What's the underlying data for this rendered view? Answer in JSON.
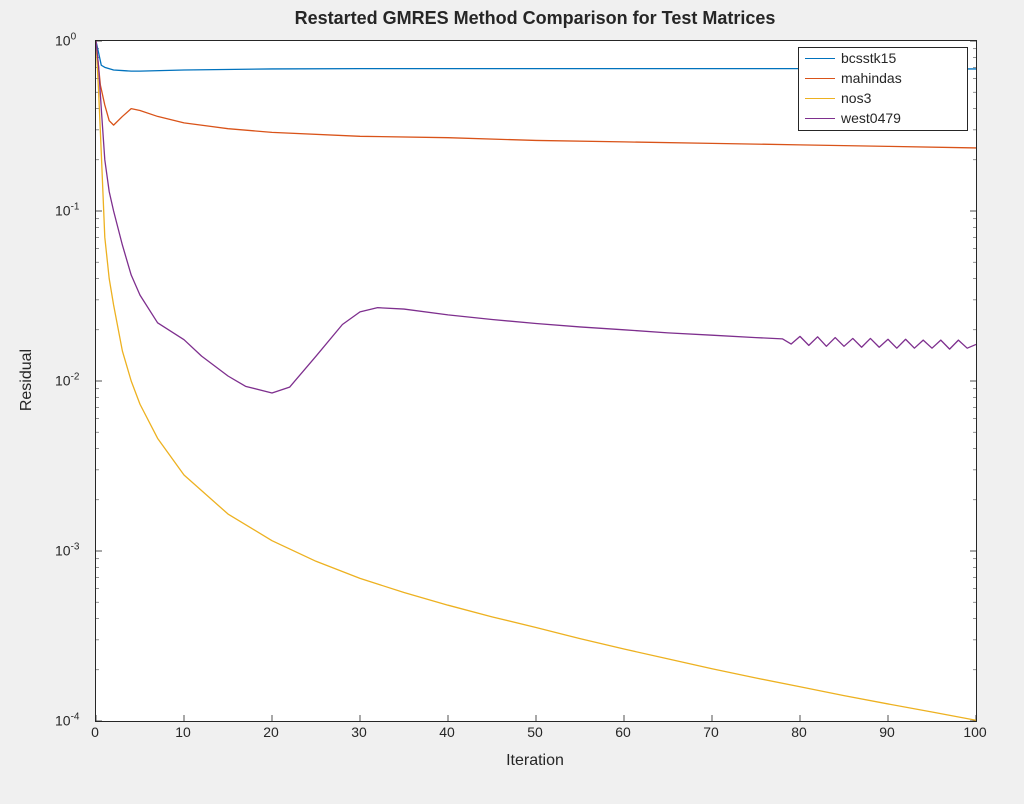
{
  "title": "Restarted GMRES Method Comparison for Test Matrices",
  "xlabel": "Iteration",
  "ylabel": "Residual",
  "xticks": [
    "0",
    "10",
    "20",
    "30",
    "40",
    "50",
    "60",
    "70",
    "80",
    "90",
    "100"
  ],
  "yticks": [
    {
      "exp": "0",
      "label": "10"
    },
    {
      "exp": "-1",
      "label": "10"
    },
    {
      "exp": "-2",
      "label": "10"
    },
    {
      "exp": "-3",
      "label": "10"
    },
    {
      "exp": "-4",
      "label": "10"
    }
  ],
  "legend": [
    {
      "label": "bcsstk15",
      "color": "#0072BD"
    },
    {
      "label": "mahindas",
      "color": "#D95319"
    },
    {
      "label": "nos3",
      "color": "#EDB120"
    },
    {
      "label": "west0479",
      "color": "#7E2F8E"
    }
  ],
  "chart_data": {
    "type": "line",
    "title": "Restarted GMRES Method Comparison for Test Matrices",
    "xlabel": "Iteration",
    "ylabel": "Residual",
    "xlim": [
      0,
      100
    ],
    "ylim": [
      0.0001,
      1
    ],
    "yscale": "log",
    "grid": false,
    "legend_position": "upper right",
    "series": [
      {
        "name": "bcsstk15",
        "color": "#0072BD",
        "x": [
          0,
          0.3,
          0.6,
          1,
          2,
          3,
          4,
          5,
          10,
          20,
          30,
          40,
          50,
          60,
          70,
          80,
          90,
          100
        ],
        "y": [
          1.0,
          0.85,
          0.72,
          0.7,
          0.675,
          0.67,
          0.665,
          0.665,
          0.675,
          0.685,
          0.688,
          0.688,
          0.688,
          0.688,
          0.688,
          0.688,
          0.685,
          0.685
        ]
      },
      {
        "name": "mahindas",
        "color": "#D95319",
        "x": [
          0,
          0.5,
          1,
          1.5,
          2,
          3,
          4,
          5,
          7,
          10,
          15,
          20,
          30,
          40,
          50,
          60,
          70,
          80,
          90,
          100
        ],
        "y": [
          1.0,
          0.55,
          0.42,
          0.34,
          0.32,
          0.36,
          0.4,
          0.39,
          0.36,
          0.33,
          0.305,
          0.29,
          0.275,
          0.27,
          0.26,
          0.255,
          0.25,
          0.245,
          0.24,
          0.235
        ]
      },
      {
        "name": "nos3",
        "color": "#EDB120",
        "x": [
          0,
          0.3,
          0.6,
          1,
          1.5,
          2,
          3,
          4,
          5,
          7,
          10,
          15,
          20,
          25,
          30,
          35,
          40,
          45,
          50,
          55,
          60,
          65,
          70,
          75,
          80,
          85,
          90,
          95,
          100
        ],
        "y": [
          1.0,
          0.5,
          0.22,
          0.07,
          0.04,
          0.028,
          0.015,
          0.01,
          0.0073,
          0.0046,
          0.0028,
          0.00165,
          0.00115,
          0.00087,
          0.00069,
          0.00057,
          0.00048,
          0.00041,
          0.000355,
          0.000305,
          0.000265,
          0.000232,
          0.000203,
          0.000179,
          0.000159,
          0.000141,
          0.000126,
          0.000113,
          0.000101
        ]
      },
      {
        "name": "west0479",
        "color": "#7E2F8E",
        "x": [
          0,
          0.3,
          0.6,
          1,
          1.5,
          2,
          3,
          4,
          5,
          7,
          10,
          12,
          15,
          17,
          20,
          22,
          25,
          28,
          30,
          32,
          35,
          40,
          45,
          50,
          55,
          60,
          65,
          70,
          75,
          78,
          79,
          80,
          81,
          82,
          83,
          84,
          85,
          86,
          87,
          88,
          89,
          90,
          91,
          92,
          93,
          94,
          95,
          96,
          97,
          98,
          99,
          100
        ],
        "y": [
          1.0,
          0.7,
          0.4,
          0.2,
          0.13,
          0.1,
          0.063,
          0.042,
          0.032,
          0.022,
          0.0175,
          0.014,
          0.0107,
          0.0093,
          0.0085,
          0.0092,
          0.014,
          0.0215,
          0.0255,
          0.027,
          0.0265,
          0.0245,
          0.023,
          0.0218,
          0.0208,
          0.02,
          0.0192,
          0.0186,
          0.018,
          0.0177,
          0.0165,
          0.0183,
          0.0162,
          0.0182,
          0.016,
          0.018,
          0.016,
          0.0178,
          0.0158,
          0.0178,
          0.0158,
          0.0176,
          0.0156,
          0.0176,
          0.0156,
          0.0174,
          0.0156,
          0.0174,
          0.0154,
          0.0174,
          0.0156,
          0.0164
        ]
      }
    ]
  }
}
